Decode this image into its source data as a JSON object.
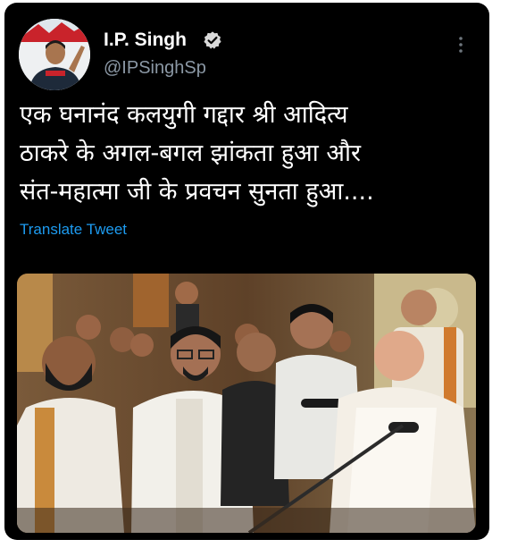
{
  "tweet": {
    "author": {
      "name": "I.P. Singh",
      "handle": "@IPSinghSp",
      "verified": true,
      "avatar_icon": "profile-photo"
    },
    "text_lines": [
      "एक घनानंद कलयुगी गद्दार श्री आदित्य",
      "ठाकरे के अगल-बगल झांकता हुआ और",
      "संत-महात्मा जी के प्रवचन सुनता हुआ...."
    ],
    "translate_label": "Translate Tweet",
    "media": {
      "type": "photo",
      "icon": "photo-icon"
    }
  },
  "colors": {
    "background": "#000000",
    "text": "#ffffff",
    "secondary_text": "#8b98a5",
    "link": "#1d9bf0",
    "verified_badge": "#d9d9d9"
  },
  "icons": {
    "verified": "verified-badge-icon",
    "more": "more-options-icon"
  }
}
